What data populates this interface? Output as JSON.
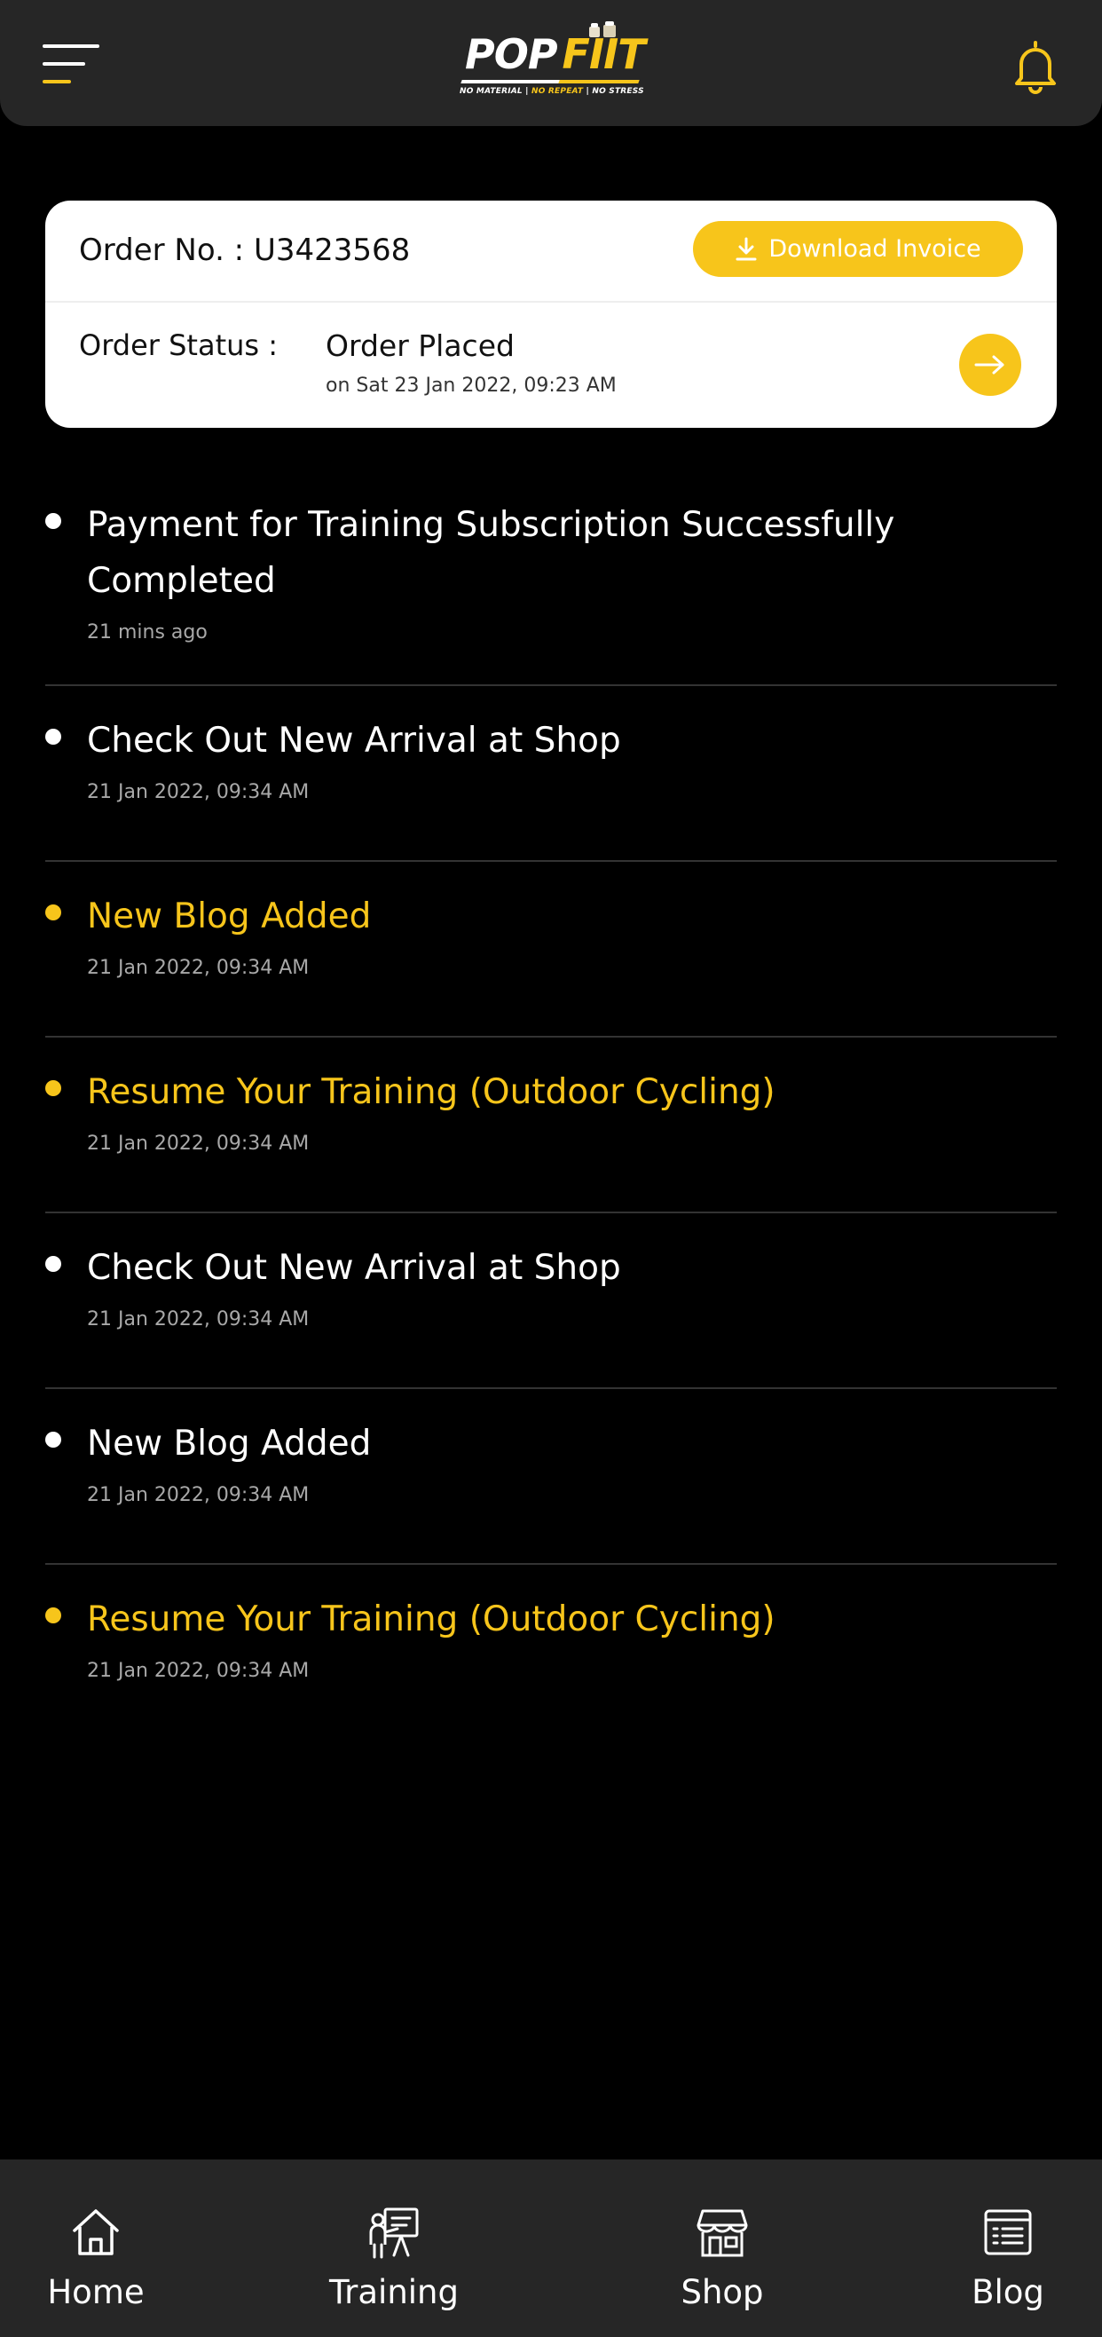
{
  "colors": {
    "accent": "#f7c51b",
    "background": "#000000",
    "header_bg": "#262626",
    "card_bg": "#ffffff"
  },
  "header": {
    "menu_icon": "hamburger-menu-icon",
    "logo": {
      "text_pop": "POP",
      "text_fiit": "FIIT",
      "tagline_1": "NO MATERIAL | ",
      "tagline_2": "NO REPEAT",
      "tagline_3": " | NO STRESS"
    },
    "bell_icon": "bell-icon"
  },
  "order": {
    "order_no": "Order No. : U3423568",
    "download_label": "Download Invoice",
    "download_icon": "download-icon",
    "status_label": "Order Status :",
    "status_value": "Order Placed",
    "status_date": "on Sat 23 Jan 2022, 09:23 AM",
    "arrow_icon": "arrow-right-icon"
  },
  "notifications": [
    {
      "title": "Payment for Training Subscription Successfully Completed",
      "time": "21 mins ago",
      "highlight": false
    },
    {
      "title": "Check Out New Arrival at Shop",
      "time": "21 Jan 2022, 09:34 AM",
      "highlight": false
    },
    {
      "title": "New Blog Added",
      "time": "21 Jan 2022, 09:34 AM",
      "highlight": true
    },
    {
      "title": "Resume Your Training (Outdoor Cycling)",
      "time": "21 Jan 2022, 09:34 AM",
      "highlight": true
    },
    {
      "title": "Check Out New Arrival at Shop",
      "time": "21 Jan 2022, 09:34 AM",
      "highlight": false
    },
    {
      "title": "New Blog Added",
      "time": "21 Jan 2022, 09:34 AM",
      "highlight": false
    },
    {
      "title": "Resume Your Training (Outdoor Cycling)",
      "time": "21 Jan 2022, 09:34 AM",
      "highlight": true
    }
  ],
  "bottom_nav": [
    {
      "label": "Home",
      "icon": "home-icon"
    },
    {
      "label": "Training",
      "icon": "training-icon"
    },
    {
      "label": "Shop",
      "icon": "shop-icon"
    },
    {
      "label": "Blog",
      "icon": "blog-icon"
    }
  ]
}
